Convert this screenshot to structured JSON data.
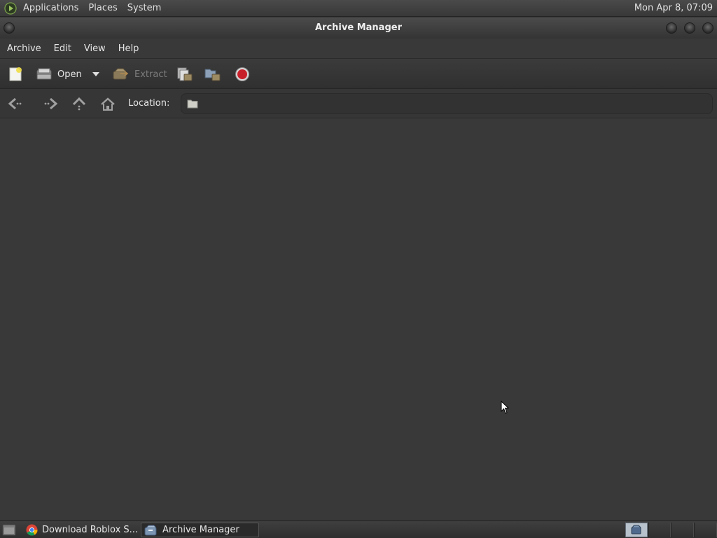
{
  "top_panel": {
    "menus": [
      "Applications",
      "Places",
      "System"
    ],
    "clock": "Mon Apr  8, 07:09"
  },
  "window": {
    "title": "Archive Manager"
  },
  "menubar": {
    "items": [
      "Archive",
      "Edit",
      "View",
      "Help"
    ]
  },
  "toolbar": {
    "open_label": "Open",
    "extract_label": "Extract",
    "extract_enabled": false
  },
  "location": {
    "label": "Location:",
    "value": ""
  },
  "taskbar": {
    "tasks": [
      {
        "label": "Download Roblox S...",
        "icon": "chrome-icon",
        "active": false
      },
      {
        "label": "Archive Manager",
        "icon": "archive-manager-icon",
        "active": true
      }
    ]
  },
  "colors": {
    "background": "#393939",
    "stop_red": "#c8202a"
  }
}
